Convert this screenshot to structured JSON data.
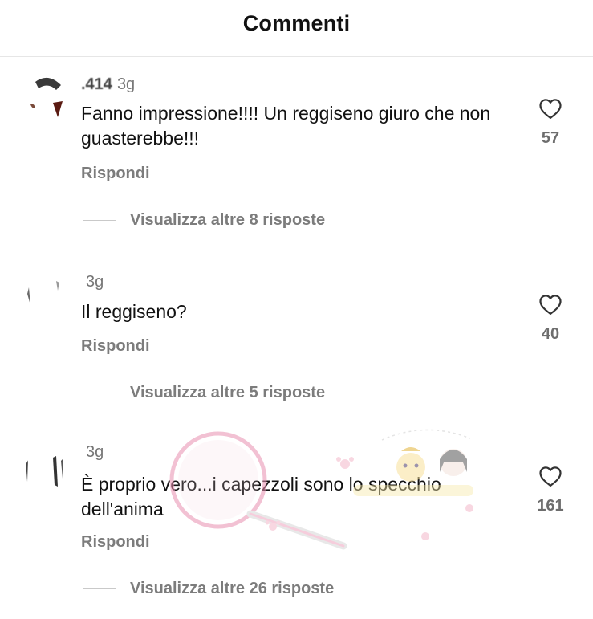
{
  "header": {
    "title": "Commenti"
  },
  "comments": [
    {
      "username": ".414",
      "time": "3g",
      "text": "Fanno impressione!!!! Un reggiseno giuro che non guasterebbe!!!",
      "reply_label": "Rispondi",
      "view_replies": "Visualizza altre 8 risposte",
      "likes": "57"
    },
    {
      "username": "",
      "time": "3g",
      "text": "Il reggiseno?",
      "reply_label": "Rispondi",
      "view_replies": "Visualizza altre 5 risposte",
      "likes": "40"
    },
    {
      "username": "",
      "time": "3g",
      "text": "È proprio vero...i capezzoli sono lo specchio dell'anima",
      "reply_label": "Rispondi",
      "view_replies": "Visualizza altre 26 risposte",
      "likes": "161"
    }
  ],
  "colors": {
    "text": "#111111",
    "secondary": "#7c7c7c",
    "divider": "#e6e6e6",
    "watermark_pink": "#e98fb0"
  },
  "icons": {
    "like": "heart-outline-icon"
  }
}
